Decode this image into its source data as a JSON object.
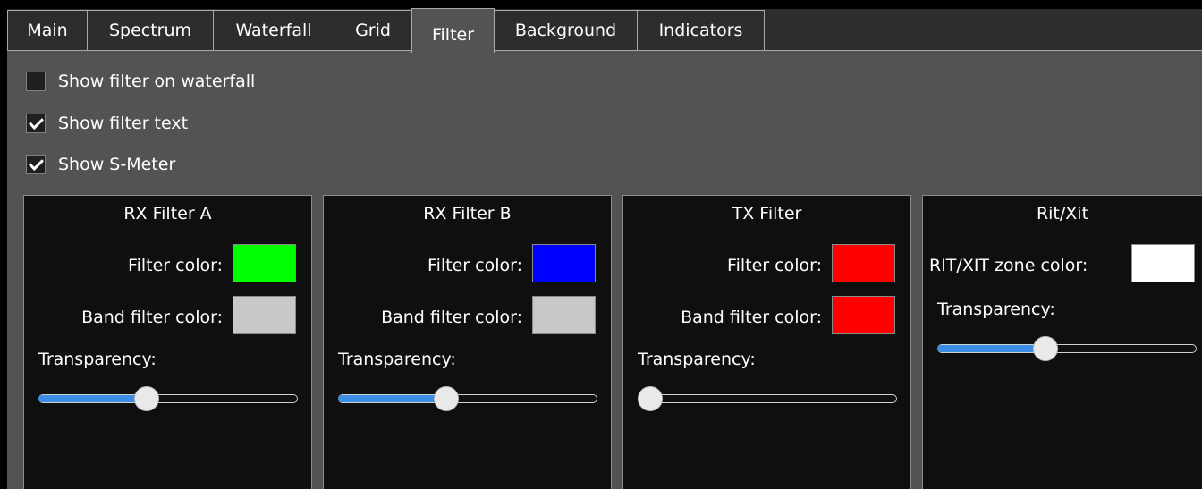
{
  "tabs": [
    {
      "label": "Main",
      "active": false
    },
    {
      "label": "Spectrum",
      "active": false
    },
    {
      "label": "Waterfall",
      "active": false
    },
    {
      "label": "Grid",
      "active": false
    },
    {
      "label": "Filter",
      "active": true
    },
    {
      "label": "Background",
      "active": false
    },
    {
      "label": "Indicators",
      "active": false
    }
  ],
  "options": [
    {
      "label": "Show filter on waterfall",
      "checked": false
    },
    {
      "label": "Show filter text",
      "checked": true
    },
    {
      "label": "Show S-Meter",
      "checked": true
    }
  ],
  "groups": [
    {
      "title": "RX Filter A",
      "filter_color_label": "Filter color:",
      "filter_color": "#00ff00",
      "band_filter_color_label": "Band filter color:",
      "band_filter_color": "#c8c8c8",
      "transparency_label": "Transparency:",
      "transparency": 0.41
    },
    {
      "title": "RX Filter B",
      "filter_color_label": "Filter color:",
      "filter_color": "#0000ff",
      "band_filter_color_label": "Band filter color:",
      "band_filter_color": "#c8c8c8",
      "transparency_label": "Transparency:",
      "transparency": 0.41
    },
    {
      "title": "TX Filter",
      "filter_color_label": "Filter color:",
      "filter_color": "#ff0000",
      "band_filter_color_label": "Band filter color:",
      "band_filter_color": "#ff0000",
      "transparency_label": "Transparency:",
      "transparency": 0.0
    },
    {
      "title": "Rit/Xit",
      "zone_color_label": "RIT/XIT zone color:",
      "zone_color": "#ffffff",
      "transparency_label": "Transparency:",
      "transparency": 0.41
    }
  ],
  "colors": {
    "background": "#535353",
    "group_background": "#0f0f0f",
    "tab_background": "#2d2d2d",
    "accent": "#3a8ee6"
  }
}
